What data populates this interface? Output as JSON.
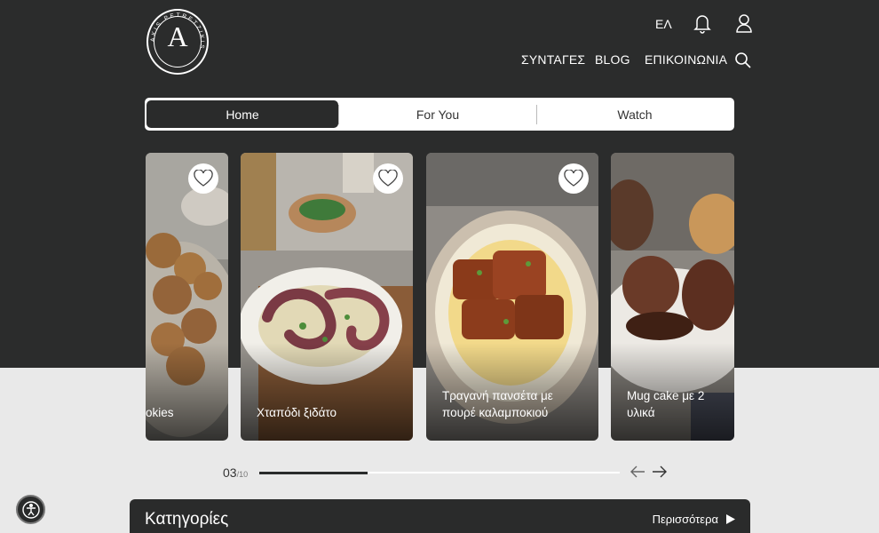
{
  "brand": {
    "logo_letter": "A",
    "logo_ring_text": "AKIS PETRETZIKIS"
  },
  "header": {
    "language": "ΕΛ",
    "icons": [
      "bell-icon",
      "user-icon",
      "search-icon"
    ],
    "nav": [
      "ΣΥΝΤΑΓΕΣ",
      "BLOG",
      "ΕΠΙΚΟΙΝΩΝΙΑ"
    ]
  },
  "tabs": [
    {
      "label": "Home",
      "active": true
    },
    {
      "label": "For You",
      "active": false
    },
    {
      "label": "Watch",
      "active": false
    }
  ],
  "carousel": {
    "cards": [
      {
        "title": "okies",
        "favorite_icon": "heart-icon"
      },
      {
        "title": "Χταπόδι ξιδάτο",
        "favorite_icon": "heart-icon"
      },
      {
        "title": "Τραγανή πανσέτα με πουρέ καλαμποκιού",
        "favorite_icon": "heart-icon"
      },
      {
        "title": "Mug cake με 2 υλικά",
        "favorite_icon": "heart-icon"
      }
    ],
    "current": "03",
    "total": "10",
    "progress": 0.3
  },
  "categories": {
    "title": "Κατηγορίες",
    "more_label": "Περισσότερα"
  },
  "accessibility": {
    "icon": "accessibility-icon"
  },
  "colors": {
    "dark": "#2b2c2c",
    "light_bg": "#e9e9e9",
    "white": "#ffffff"
  }
}
